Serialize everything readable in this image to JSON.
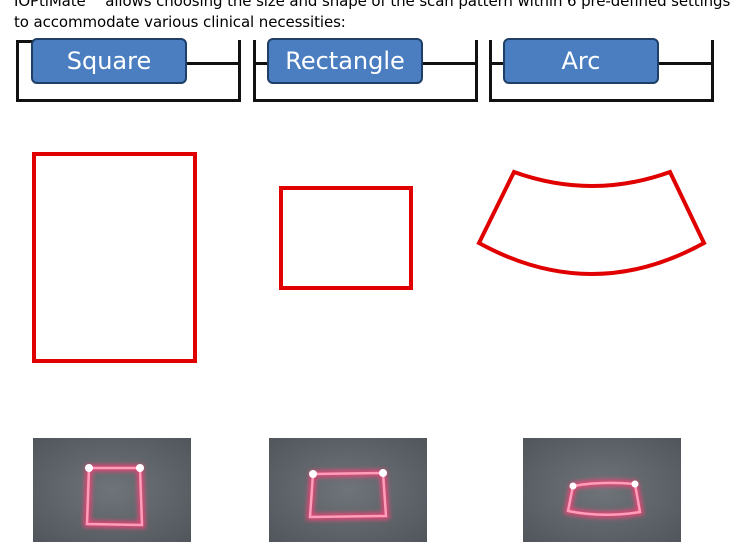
{
  "intro": {
    "line1": "IOPtiMate™ allows choosing the size and shape of the scan pattern within 6 pre-defined settings",
    "line2": "to accommodate various clinical necessities:"
  },
  "tabs": [
    {
      "label": "Square"
    },
    {
      "label": "Rectangle"
    },
    {
      "label": "Arc"
    }
  ],
  "colors": {
    "tab_fill": "#4a7ec0",
    "tab_border": "#1f3f66",
    "shape_stroke": "#e00000",
    "laser": "#ff5a8c"
  },
  "icons": {
    "square_shape": "square-outline-icon",
    "rectangle_shape": "rectangle-outline-icon",
    "arc_shape": "arc-outline-icon"
  }
}
